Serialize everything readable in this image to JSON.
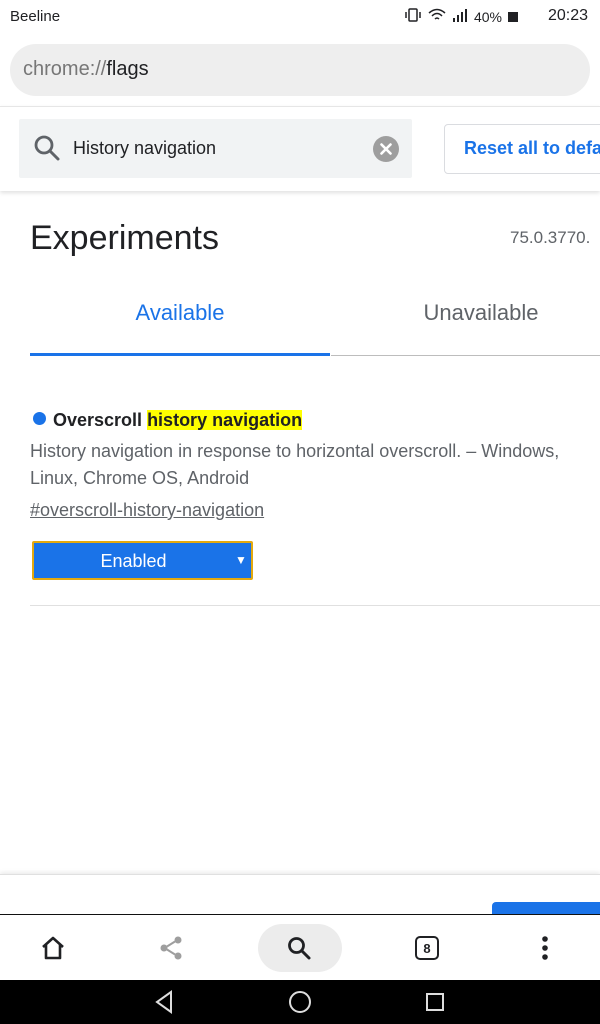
{
  "status_bar": {
    "carrier": "Beeline",
    "battery": "40%",
    "time": "20:23"
  },
  "url_bar": {
    "scheme": "chrome://",
    "host": "flags"
  },
  "search": {
    "value": "History navigation",
    "reset_label": "Reset all to default"
  },
  "header": {
    "title": "Experiments",
    "version": "75.0.3770."
  },
  "tabs": [
    {
      "label": "Available",
      "active": true
    },
    {
      "label": "Unavailable",
      "active": false
    }
  ],
  "flag": {
    "title_prefix": "Overscroll ",
    "title_highlight": "history navigation",
    "description": "History navigation in response to horizontal overscroll. – Windows, Linux, Chrome OS, Android",
    "link": "#overscroll-history-navigation",
    "selected_option": "Enabled"
  },
  "toolbar": {
    "tab_count": "8"
  },
  "colors": {
    "accent": "#1a73e8",
    "highlight": "#ffff00"
  }
}
